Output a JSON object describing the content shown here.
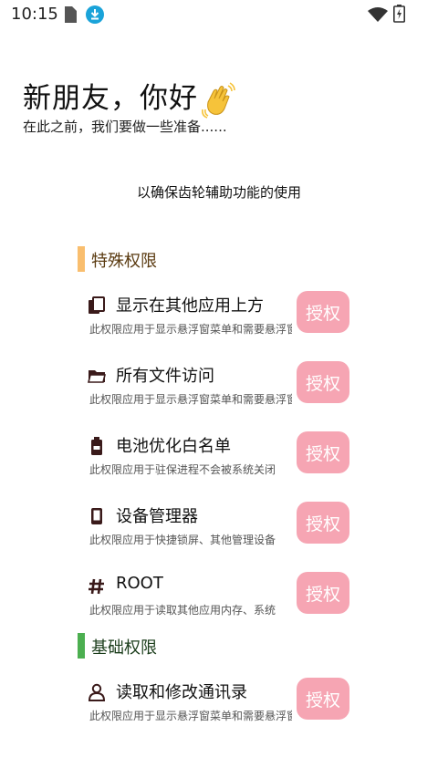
{
  "status_bar": {
    "time": "10:15",
    "icons": [
      "sim-card-icon",
      "download-icon",
      "wifi-icon",
      "battery-charging-icon"
    ],
    "download_color": "#1aa3d9"
  },
  "greeting": {
    "title": "新朋友，你好",
    "emoji_icon": "waving-hand-icon",
    "subtitle": "在此之前，我们要做一些准备......"
  },
  "notice": "以确保齿轮辅助功能的使用",
  "colors": {
    "special_accent": "#f9be6e",
    "basic_accent": "#4caf50",
    "special_label": "#5a3a10",
    "basic_label": "#1b3d1b",
    "button_bg": "#f6a5b3",
    "icon": "#3a1a1a"
  },
  "sections": {
    "special": {
      "label": "特殊权限",
      "items": [
        {
          "icon": "overlay-window-icon",
          "title": "显示在其他应用上方",
          "desc": "此权限应用于显示悬浮窗菜单和需要悬浮窗",
          "button": "授权"
        },
        {
          "icon": "folder-icon",
          "title": "所有文件访问",
          "desc": "此权限应用于显示悬浮窗菜单和需要悬浮窗",
          "button": "授权"
        },
        {
          "icon": "battery-icon",
          "title": "电池优化白名单",
          "desc": "此权限应用于驻保进程不会被系统关闭",
          "button": "授权"
        },
        {
          "icon": "phone-device-icon",
          "title": "设备管理器",
          "desc": "此权限应用于快捷锁屏、其他管理设备",
          "button": "授权"
        },
        {
          "icon": "hashtag-icon",
          "title": "ROOT",
          "desc": "此权限应用于读取其他应用内存、系统",
          "button": "授权"
        }
      ]
    },
    "basic": {
      "label": "基础权限",
      "items": [
        {
          "icon": "contact-person-icon",
          "title": "读取和修改通讯录",
          "desc": "此权限应用于显示悬浮窗菜单和需要悬浮窗",
          "button": "授权"
        }
      ]
    }
  }
}
